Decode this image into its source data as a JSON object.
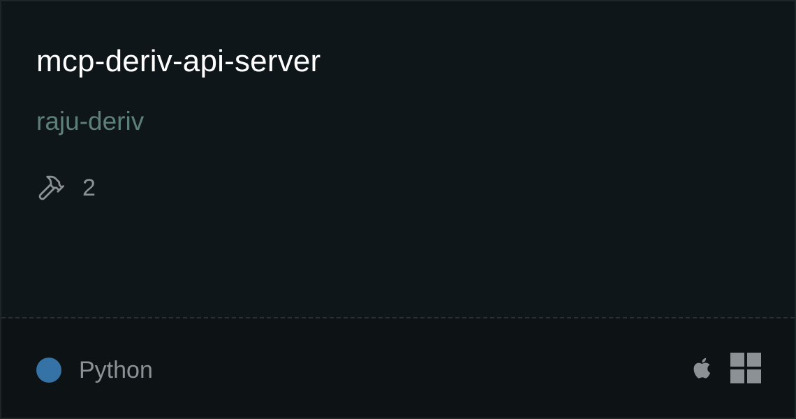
{
  "card": {
    "title": "mcp-deriv-api-server",
    "author": "raju-deriv",
    "tools": {
      "icon": "hammer-icon",
      "count": "2"
    },
    "language": {
      "name": "Python",
      "color": "#3572a5"
    },
    "platforms": [
      {
        "name": "apple",
        "icon": "apple-icon"
      },
      {
        "name": "windows",
        "icon": "windows-icon"
      }
    ]
  },
  "colors": {
    "background": "#0f1619",
    "footer_background": "#0d1215",
    "title": "#ffffff",
    "author": "#5d7f79",
    "muted": "#8b9194"
  }
}
